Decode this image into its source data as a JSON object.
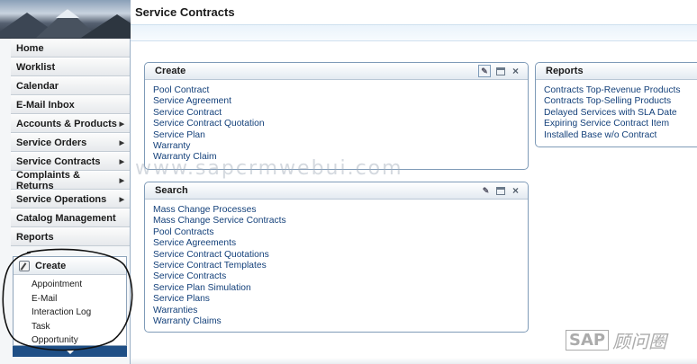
{
  "title": "Service Contracts",
  "nav": [
    {
      "label": "Home",
      "arrow": false
    },
    {
      "label": "Worklist",
      "arrow": false
    },
    {
      "label": "Calendar",
      "arrow": false
    },
    {
      "label": "E-Mail Inbox",
      "arrow": false
    },
    {
      "label": "Accounts & Products",
      "arrow": true
    },
    {
      "label": "Service Orders",
      "arrow": true
    },
    {
      "label": "Service Contracts",
      "arrow": true
    },
    {
      "label": "Complaints & Returns",
      "arrow": true
    },
    {
      "label": "Service Operations",
      "arrow": true
    },
    {
      "label": "Catalog Management",
      "arrow": false
    },
    {
      "label": "Reports",
      "arrow": false
    }
  ],
  "quick_create": {
    "title": "Create",
    "items": [
      "Appointment",
      "E-Mail",
      "Interaction Log",
      "Task",
      "Opportunity"
    ]
  },
  "create_panel": {
    "title": "Create",
    "links": [
      "Pool Contract",
      "Service Agreement",
      "Service Contract",
      "Service Contract Quotation",
      "Service Plan",
      "Warranty",
      "Warranty Claim"
    ]
  },
  "search_panel": {
    "title": "Search",
    "links": [
      "Mass Change Processes",
      "Mass Change Service Contracts",
      "Pool Contracts",
      "Service Agreements",
      "Service Contract Quotations",
      "Service Contract Templates",
      "Service Contracts",
      "Service Plan Simulation",
      "Service Plans",
      "Warranties",
      "Warranty Claims"
    ]
  },
  "reports_panel": {
    "title": "Reports",
    "links": [
      "Contracts Top-Revenue Products",
      "Contracts Top-Selling Products",
      "Delayed Services with SLA Date",
      "Expiring Service Contract Item",
      "Installed Base w/o Contract"
    ]
  },
  "watermark": "www.sapcrmwebui.com",
  "logo": {
    "brand": "SAP",
    "text": "顾问圈"
  },
  "icons": {
    "panel_tools": [
      "personalize-icon",
      "window-icon",
      "close-icon"
    ],
    "create": "pencil-icon",
    "expand": "chevron-down-icon"
  }
}
